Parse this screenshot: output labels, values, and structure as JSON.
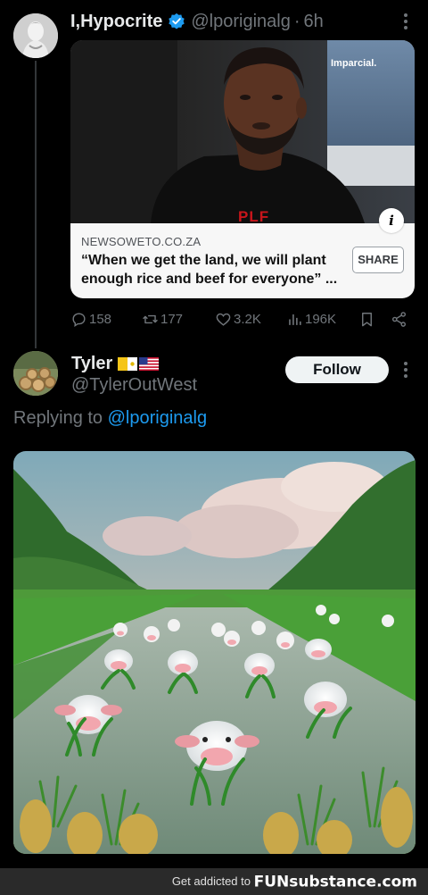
{
  "tweet1": {
    "display_name": "I,Hypocrite",
    "handle": "@lporiginalg",
    "separator": "·",
    "time": "6h",
    "card": {
      "photo_caption": "Imparcial.",
      "shirt_text": "PLF",
      "domain": "NEWSOWETO.CO.ZA",
      "title": "“When we get the land, we will plant enough rice and beef for everyone” ...",
      "share_label": "SHARE",
      "info_icon": "i"
    },
    "actions": {
      "replies": "158",
      "retweets": "177",
      "likes": "3.2K",
      "views": "196K"
    }
  },
  "tweet2": {
    "display_name": "Tyler",
    "handle": "@TylerOutWest",
    "follow_label": "Follow",
    "replying_prefix": "Replying to",
    "replying_to": "@lporiginalg"
  },
  "footer": {
    "text": "Get addicted to",
    "brand": "FUNsubstance.com"
  },
  "colors": {
    "accent": "#1d9bf0",
    "background": "#000000",
    "muted": "#71767b"
  },
  "icons": [
    "verified-badge-icon",
    "more-icon",
    "reply-icon",
    "retweet-icon",
    "like-icon",
    "views-icon",
    "bookmark-icon",
    "share-icon",
    "info-icon"
  ]
}
